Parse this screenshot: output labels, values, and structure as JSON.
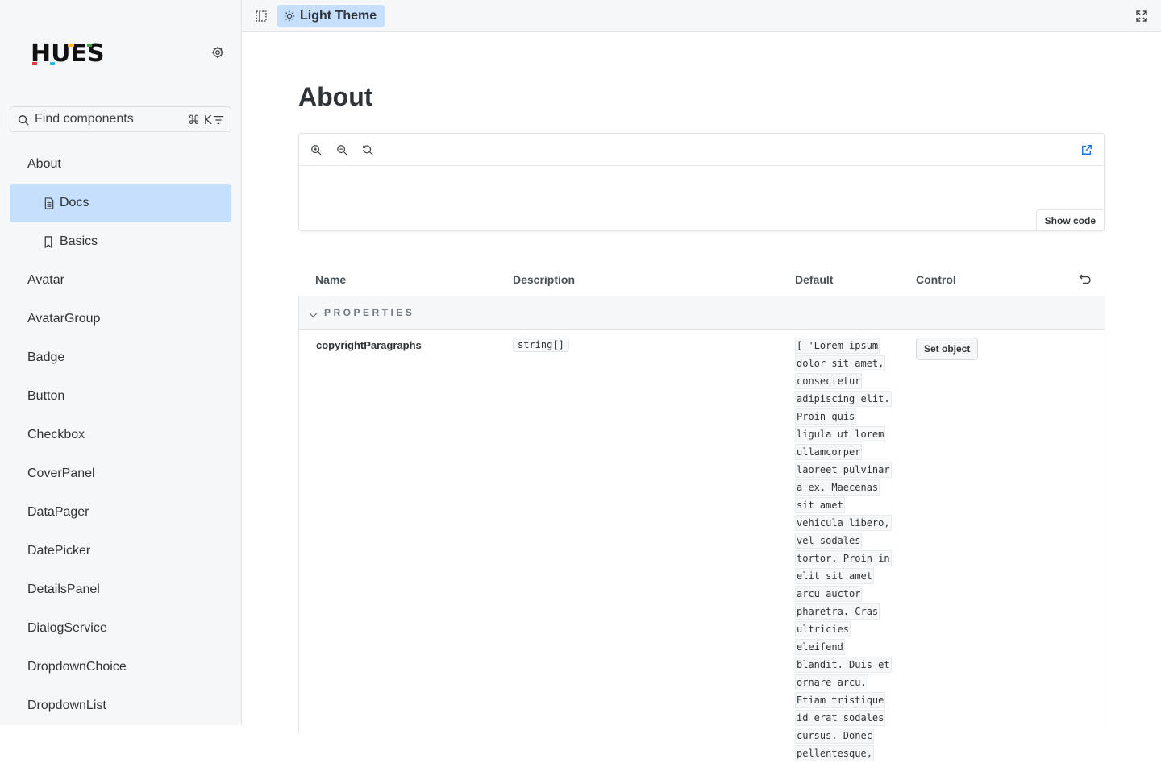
{
  "sidebar": {
    "logo_text": "HUES",
    "search": {
      "placeholder": "Find components",
      "shortcut": "⌘ K"
    },
    "items": [
      {
        "label": "About"
      },
      {
        "label": "Docs"
      },
      {
        "label": "Basics"
      },
      {
        "label": "Avatar"
      },
      {
        "label": "AvatarGroup"
      },
      {
        "label": "Badge"
      },
      {
        "label": "Button"
      },
      {
        "label": "Checkbox"
      },
      {
        "label": "CoverPanel"
      },
      {
        "label": "DataPager"
      },
      {
        "label": "DatePicker"
      },
      {
        "label": "DetailsPanel"
      },
      {
        "label": "DialogService"
      },
      {
        "label": "DropdownChoice"
      },
      {
        "label": "DropdownList"
      }
    ]
  },
  "toolbar": {
    "theme_label": "Light Theme"
  },
  "main": {
    "title": "About",
    "preview": {
      "show_code_label": "Show code"
    },
    "table": {
      "headers": {
        "name": "Name",
        "description": "Description",
        "default": "Default",
        "control": "Control"
      },
      "section_title": "PROPERTIES",
      "row": {
        "name": "copyrightParagraphs",
        "type": "string[]",
        "default_lines": [
          "[ 'Lorem ipsum",
          "dolor sit amet,",
          "consectetur",
          "adipiscing elit.",
          "Proin quis",
          "ligula ut lorem",
          "ullamcorper",
          "laoreet pulvinar",
          "a ex. Maecenas",
          "sit amet",
          "vehicula libero,",
          "vel sodales",
          "tortor. Proin in",
          "elit sit amet",
          "arcu auctor",
          "pharetra. Cras",
          "ultricies",
          "eleifend",
          "blandit. Duis et",
          "ornare arcu.",
          "Etiam tristique",
          "id erat sodales",
          "cursus. Donec",
          "pellentesque,"
        ],
        "control_label": "Set object"
      }
    }
  },
  "colors": {
    "accent": "#c6dffd",
    "sidebar_bg": "#f6f7f9",
    "link_blue": "#1a73d9"
  }
}
